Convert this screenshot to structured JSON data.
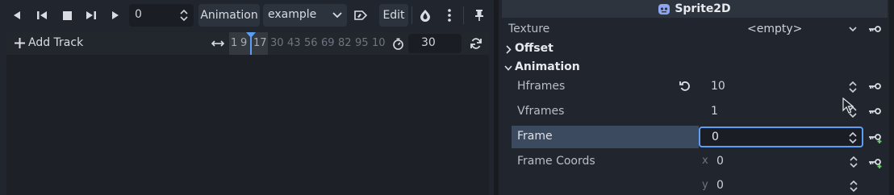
{
  "toolbar": {
    "frame_value": "0",
    "animation_button": "Animation",
    "animation_selected": "example",
    "edit_button": "Edit"
  },
  "tracks": {
    "add_track_label": "Add Track",
    "ruler_ticks": [
      "1",
      "9",
      "17",
      "30",
      "43",
      "56",
      "69",
      "82",
      "95",
      "10"
    ],
    "fps_value": "30"
  },
  "inspector": {
    "title": "Sprite2D",
    "texture": {
      "label": "Texture",
      "value": "<empty>"
    },
    "sections": {
      "offset": "Offset",
      "animation": "Animation"
    },
    "hframes": {
      "label": "Hframes",
      "value": "10"
    },
    "vframes": {
      "label": "Vframes",
      "value": "1"
    },
    "frame": {
      "label": "Frame",
      "value": "0"
    },
    "frame_coords": {
      "label": "Frame Coords",
      "x_label": "x",
      "x_value": "0",
      "y_label": "y",
      "y_value": "0"
    }
  },
  "colors": {
    "accent": "#5c9df5",
    "selected_row": "#3b4a5e",
    "panel_bg": "#21262e",
    "field_bg": "#1a1e24"
  },
  "icons": [
    "play-backwards-icon",
    "step-back-icon",
    "stop-icon",
    "step-forward-icon",
    "play-icon",
    "rename-icon",
    "onion-skin-icon",
    "more-icon",
    "pin-icon",
    "plus-icon",
    "timeline-fit-icon",
    "timer-icon",
    "loop-icon",
    "sprite-node-icon",
    "chevron-down-icon",
    "key-icon",
    "revert-icon",
    "key-add-icon",
    "mouse-cursor-icon"
  ]
}
